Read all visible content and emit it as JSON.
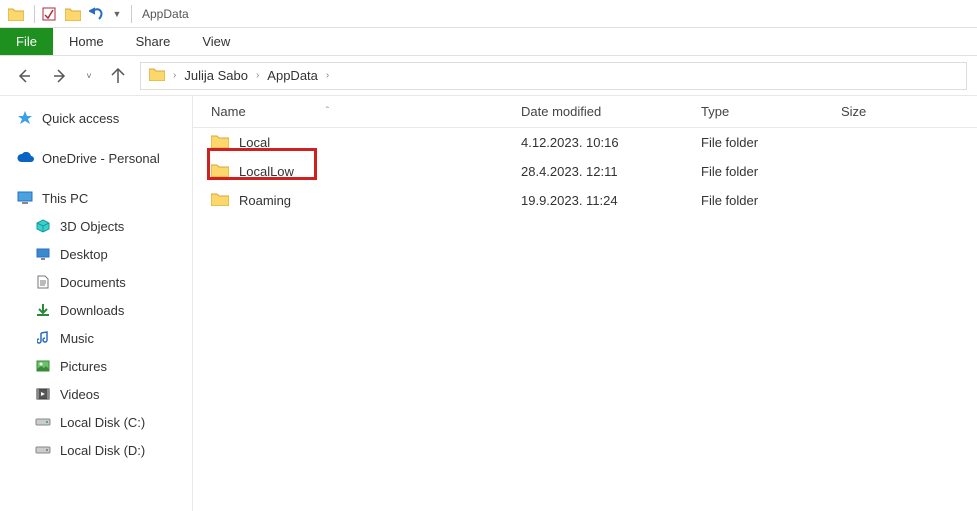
{
  "window_title": "AppData",
  "ribbon": {
    "tabs": [
      "File",
      "Home",
      "Share",
      "View"
    ]
  },
  "breadcrumb": {
    "segments": [
      "Julija Sabo",
      "AppData"
    ]
  },
  "sidebar": {
    "quickaccess": "Quick access",
    "onedrive": "OneDrive - Personal",
    "thispc": "This PC",
    "items": [
      "3D Objects",
      "Desktop",
      "Documents",
      "Downloads",
      "Music",
      "Pictures",
      "Videos",
      "Local Disk (C:)",
      "Local Disk (D:)"
    ]
  },
  "columns": {
    "name": "Name",
    "date": "Date modified",
    "type": "Type",
    "size": "Size"
  },
  "rows": [
    {
      "name": "Local",
      "date": "4.12.2023. 10:16",
      "type": "File folder"
    },
    {
      "name": "LocalLow",
      "date": "28.4.2023. 12:11",
      "type": "File folder"
    },
    {
      "name": "Roaming",
      "date": "19.9.2023. 11:24",
      "type": "File folder"
    }
  ]
}
